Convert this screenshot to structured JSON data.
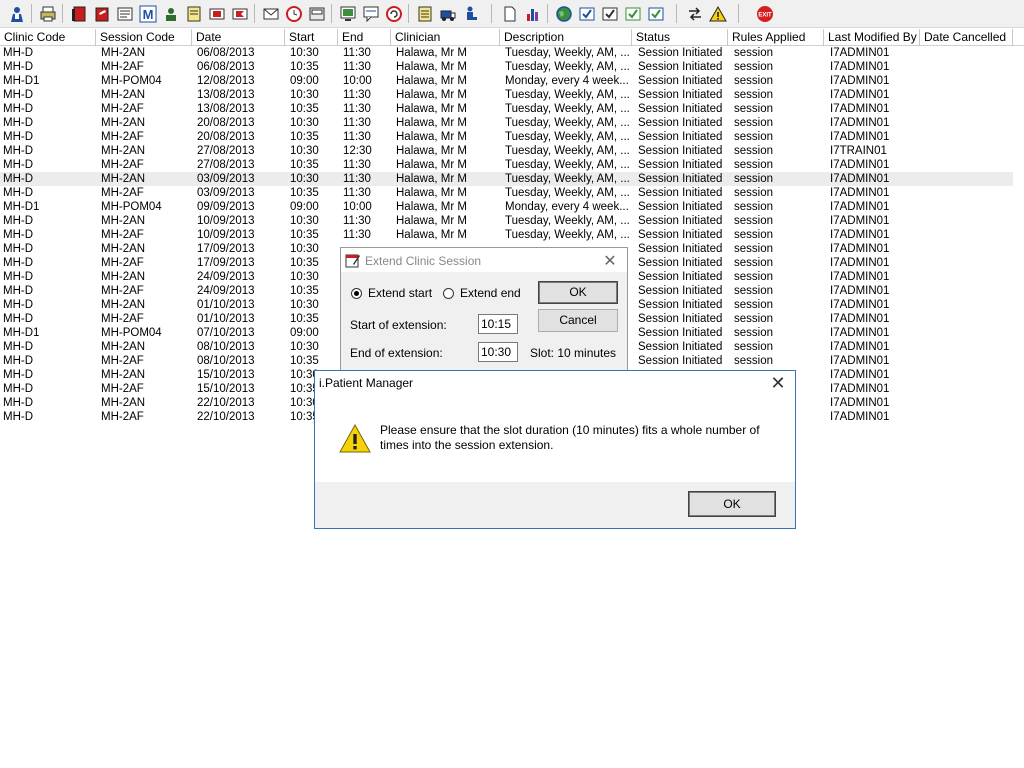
{
  "toolbar": {
    "icons": [
      "person-icon",
      "printer-icon",
      "book-icon",
      "notebook-icon",
      "notes-icon",
      "letter-m-icon",
      "user-card-icon",
      "document-edit-icon",
      "flag-icon",
      "flag-red-icon",
      "envelope-icon",
      "clock-icon",
      "card-icon",
      "screen-icon",
      "chat-icon",
      "refresh-circle-icon",
      "notepad-icon",
      "truck-icon",
      "person-chair-icon",
      "blank-page-icon",
      "bar-chart-icon",
      "globe-icon",
      "check-doc-icon",
      "check-doc-2-icon",
      "check-green-icon",
      "check-blue-icon",
      "swap-arrows-icon",
      "warning-icon",
      "exit-icon"
    ]
  },
  "grid": {
    "columns": [
      "Clinic Code",
      "Session Code",
      "Date",
      "Start",
      "End",
      "Clinician",
      "Description",
      "Status",
      "Rules Applied",
      "Last Modified By",
      "Date Cancelled"
    ],
    "rows": [
      [
        "MH-D",
        "MH-2AN",
        "06/08/2013",
        "10:30",
        "11:30",
        "Halawa, Mr M",
        "Tuesday, Weekly, AM, ...",
        "Session Initiated",
        "session",
        "I7ADMIN01",
        ""
      ],
      [
        "MH-D",
        "MH-2AF",
        "06/08/2013",
        "10:35",
        "11:30",
        "Halawa, Mr M",
        "Tuesday, Weekly, AM, ...",
        "Session Initiated",
        "session",
        "I7ADMIN01",
        ""
      ],
      [
        "MH-D1",
        "MH-POM04",
        "12/08/2013",
        "09:00",
        "10:00",
        "Halawa, Mr M",
        "Monday, every 4 week...",
        "Session Initiated",
        "session",
        "I7ADMIN01",
        ""
      ],
      [
        "MH-D",
        "MH-2AN",
        "13/08/2013",
        "10:30",
        "11:30",
        "Halawa, Mr M",
        "Tuesday, Weekly, AM, ...",
        "Session Initiated",
        "session",
        "I7ADMIN01",
        ""
      ],
      [
        "MH-D",
        "MH-2AF",
        "13/08/2013",
        "10:35",
        "11:30",
        "Halawa, Mr M",
        "Tuesday, Weekly, AM, ...",
        "Session Initiated",
        "session",
        "I7ADMIN01",
        ""
      ],
      [
        "MH-D",
        "MH-2AN",
        "20/08/2013",
        "10:30",
        "11:30",
        "Halawa, Mr M",
        "Tuesday, Weekly, AM, ...",
        "Session Initiated",
        "session",
        "I7ADMIN01",
        ""
      ],
      [
        "MH-D",
        "MH-2AF",
        "20/08/2013",
        "10:35",
        "11:30",
        "Halawa, Mr M",
        "Tuesday, Weekly, AM, ...",
        "Session Initiated",
        "session",
        "I7ADMIN01",
        ""
      ],
      [
        "MH-D",
        "MH-2AN",
        "27/08/2013",
        "10:30",
        "12:30",
        "Halawa, Mr M",
        "Tuesday, Weekly, AM, ...",
        "Session Initiated",
        "session",
        "I7TRAIN01",
        ""
      ],
      [
        "MH-D",
        "MH-2AF",
        "27/08/2013",
        "10:35",
        "11:30",
        "Halawa, Mr M",
        "Tuesday, Weekly, AM, ...",
        "Session Initiated",
        "session",
        "I7ADMIN01",
        ""
      ],
      [
        "MH-D",
        "MH-2AN",
        "03/09/2013",
        "10:30",
        "11:30",
        "Halawa, Mr M",
        "Tuesday, Weekly, AM, ...",
        "Session Initiated",
        "session",
        "I7ADMIN01",
        ""
      ],
      [
        "MH-D",
        "MH-2AF",
        "03/09/2013",
        "10:35",
        "11:30",
        "Halawa, Mr M",
        "Tuesday, Weekly, AM, ...",
        "Session Initiated",
        "session",
        "I7ADMIN01",
        ""
      ],
      [
        "MH-D1",
        "MH-POM04",
        "09/09/2013",
        "09:00",
        "10:00",
        "Halawa, Mr M",
        "Monday, every 4 week...",
        "Session Initiated",
        "session",
        "I7ADMIN01",
        ""
      ],
      [
        "MH-D",
        "MH-2AN",
        "10/09/2013",
        "10:30",
        "11:30",
        "Halawa, Mr M",
        "Tuesday, Weekly, AM, ...",
        "Session Initiated",
        "session",
        "I7ADMIN01",
        ""
      ],
      [
        "MH-D",
        "MH-2AF",
        "10/09/2013",
        "10:35",
        "11:30",
        "Halawa, Mr M",
        "Tuesday, Weekly, AM, ...",
        "Session Initiated",
        "session",
        "I7ADMIN01",
        ""
      ],
      [
        "MH-D",
        "MH-2AN",
        "17/09/2013",
        "10:30",
        "",
        "",
        "",
        "Session Initiated",
        "session",
        "I7ADMIN01",
        ""
      ],
      [
        "MH-D",
        "MH-2AF",
        "17/09/2013",
        "10:35",
        "",
        "",
        "",
        "Session Initiated",
        "session",
        "I7ADMIN01",
        ""
      ],
      [
        "MH-D",
        "MH-2AN",
        "24/09/2013",
        "10:30",
        "",
        "",
        "",
        "Session Initiated",
        "session",
        "I7ADMIN01",
        ""
      ],
      [
        "MH-D",
        "MH-2AF",
        "24/09/2013",
        "10:35",
        "",
        "",
        "",
        "Session Initiated",
        "session",
        "I7ADMIN01",
        ""
      ],
      [
        "MH-D",
        "MH-2AN",
        "01/10/2013",
        "10:30",
        "",
        "",
        "",
        "Session Initiated",
        "session",
        "I7ADMIN01",
        ""
      ],
      [
        "MH-D",
        "MH-2AF",
        "01/10/2013",
        "10:35",
        "",
        "",
        "",
        "Session Initiated",
        "session",
        "I7ADMIN01",
        ""
      ],
      [
        "MH-D1",
        "MH-POM04",
        "07/10/2013",
        "09:00",
        "",
        "",
        "",
        "Session Initiated",
        "session",
        "I7ADMIN01",
        ""
      ],
      [
        "MH-D",
        "MH-2AN",
        "08/10/2013",
        "10:30",
        "",
        "",
        "",
        "Session Initiated",
        "session",
        "I7ADMIN01",
        ""
      ],
      [
        "MH-D",
        "MH-2AF",
        "08/10/2013",
        "10:35",
        "",
        "",
        "",
        "Session Initiated",
        "session",
        "I7ADMIN01",
        ""
      ],
      [
        "MH-D",
        "MH-2AN",
        "15/10/2013",
        "10:30",
        "",
        "",
        "",
        "",
        "",
        "I7ADMIN01",
        ""
      ],
      [
        "MH-D",
        "MH-2AF",
        "15/10/2013",
        "10:35",
        "",
        "",
        "",
        "",
        "",
        "I7ADMIN01",
        ""
      ],
      [
        "MH-D",
        "MH-2AN",
        "22/10/2013",
        "10:30",
        "",
        "",
        "",
        "",
        "",
        "I7ADMIN01",
        ""
      ],
      [
        "MH-D",
        "MH-2AF",
        "22/10/2013",
        "10:35",
        "",
        "",
        "",
        "",
        "",
        "I7ADMIN01",
        ""
      ]
    ],
    "selected_row": 9
  },
  "extend_dialog": {
    "title": "Extend Clinic Session",
    "radio_start": "Extend start",
    "radio_end": "Extend end",
    "start_label": "Start of extension:",
    "start_value": "10:15",
    "end_label": "End of extension:",
    "end_value": "10:30",
    "slot_text": "Slot: 10 minutes",
    "ok": "OK",
    "cancel": "Cancel"
  },
  "message_box": {
    "title": "i.Patient Manager",
    "message": "Please ensure that the slot duration (10 minutes) fits a whole number of times into the session extension.",
    "ok": "OK"
  },
  "colors": {
    "selected_row": "#ececec",
    "dialog_border": "#3a72b8"
  }
}
